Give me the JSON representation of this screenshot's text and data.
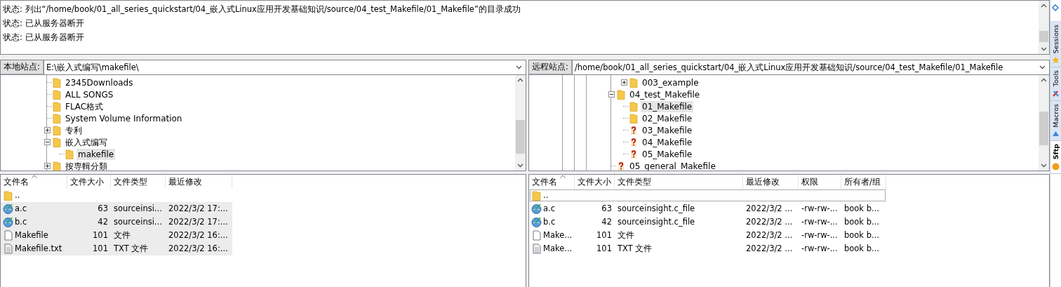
{
  "status_log": {
    "lines": [
      "状态: 列出“/home/book/01_all_series_quickstart/04_嵌入式Linux应用开发基础知识/source/04_test_Makefile/01_Makefile”的目录成功",
      "状态: 已从服务器断开",
      "状态: 已从服务器断开"
    ]
  },
  "local": {
    "site_label": "本地站点:",
    "path": "E:\\嵌入式编写\\makefile\\",
    "tree": [
      {
        "label": "2345Downloads",
        "kind": "folder",
        "selected": false
      },
      {
        "label": "ALL SONGS",
        "kind": "folder",
        "selected": false
      },
      {
        "label": "FLAC格式",
        "kind": "folder",
        "selected": false
      },
      {
        "label": "System Volume Information",
        "kind": "folder",
        "selected": false
      },
      {
        "label": "专利",
        "kind": "folder",
        "expanded": false,
        "selected": false
      },
      {
        "label": "嵌入式编写",
        "kind": "folder",
        "expanded": true,
        "selected": false,
        "children": [
          {
            "label": "makefile",
            "kind": "folder",
            "selected": true
          }
        ]
      },
      {
        "label": "按専輯分類",
        "kind": "folder",
        "expanded": false,
        "selected": false
      }
    ],
    "file_list": {
      "columns": [
        {
          "label": "文件名",
          "sorted": true
        },
        {
          "label": "文件大小",
          "sorted": false
        },
        {
          "label": "文件类型",
          "sorted": false
        },
        {
          "label": "最近修改",
          "sorted": false
        }
      ],
      "rows": [
        {
          "kind": "folder",
          "cells": [
            ".."
          ],
          "selected": false,
          "focused": false
        },
        {
          "kind": "c-file",
          "cells": [
            "a.c",
            "63",
            "sourceinsi...",
            "2022/3/2 17:..."
          ],
          "selected": true,
          "focused": false
        },
        {
          "kind": "c-file",
          "cells": [
            "b.c",
            "42",
            "sourceinsi...",
            "2022/3/2 17:..."
          ],
          "selected": true,
          "focused": false
        },
        {
          "kind": "file",
          "cells": [
            "Makefile",
            "101",
            "文件",
            "2022/3/2 16:..."
          ],
          "selected": true,
          "focused": false
        },
        {
          "kind": "text-file",
          "cells": [
            "Makefile.txt",
            "101",
            "TXT 文件",
            "2022/3/2 16:..."
          ],
          "selected": true,
          "focused": false
        }
      ]
    }
  },
  "remote": {
    "site_label": "远程站点:",
    "path": "/home/book/01_all_series_quickstart/04_嵌入式Linux应用开发基础知识/source/04_test_Makefile/01_Makefile",
    "tree": [
      {
        "children": [
          {
            "label": "003_example",
            "kind": "folder",
            "expanded": false,
            "selected": false
          }
        ]
      },
      {
        "label": "04_test_Makefile",
        "kind": "folder",
        "expanded": true,
        "selected": false,
        "children": [
          {
            "label": "01_Makefile",
            "kind": "folder",
            "selected": true
          },
          {
            "label": "02_Makefile",
            "kind": "folder",
            "selected": false
          },
          {
            "label": "03_Makefile",
            "kind": "unknown",
            "selected": false
          },
          {
            "label": "04_Makefile",
            "kind": "unknown",
            "selected": false
          },
          {
            "label": "05_Makefile",
            "kind": "unknown",
            "selected": false
          }
        ]
      },
      {
        "label": "05_general_Makefile",
        "kind": "unknown",
        "selected": false
      }
    ],
    "file_list": {
      "columns": [
        {
          "label": "文件名",
          "sorted": true
        },
        {
          "label": "文件大小",
          "sorted": false
        },
        {
          "label": "文件类型",
          "sorted": false
        },
        {
          "label": "最近修改",
          "sorted": false
        },
        {
          "label": "权限",
          "sorted": false
        },
        {
          "label": "所有者/组",
          "sorted": false
        }
      ],
      "rows": [
        {
          "kind": "folder",
          "cells": [
            ".."
          ],
          "selected": false,
          "focused": true
        },
        {
          "kind": "c-file",
          "cells": [
            "a.c",
            "63",
            "sourceinsight.c_file",
            "2022/3/2 ...",
            "-rw-rw-...",
            "book b..."
          ],
          "selected": false,
          "focused": false
        },
        {
          "kind": "c-file",
          "cells": [
            "b.c",
            "42",
            "sourceinsight.c_file",
            "2022/3/2 ...",
            "-rw-rw-...",
            "book b..."
          ],
          "selected": false,
          "focused": false
        },
        {
          "kind": "file",
          "cells": [
            "Make...",
            "101",
            "文件",
            "2022/3/2 ...",
            "-rw-rw-...",
            "book b..."
          ],
          "selected": false,
          "focused": false
        },
        {
          "kind": "text-file",
          "cells": [
            "Make...",
            "101",
            "TXT 文件",
            "2022/3/2 ...",
            "-rw-rw-...",
            "book b..."
          ],
          "selected": false,
          "focused": false
        }
      ]
    }
  },
  "sidebar_tabs": [
    {
      "label": "Sessions",
      "kind": "star",
      "selected": false
    },
    {
      "label": "Tools",
      "kind": "tools",
      "selected": false
    },
    {
      "label": "Macros",
      "kind": "macros",
      "selected": false
    },
    {
      "label": "Sftp",
      "kind": "sftp",
      "selected": true
    }
  ]
}
